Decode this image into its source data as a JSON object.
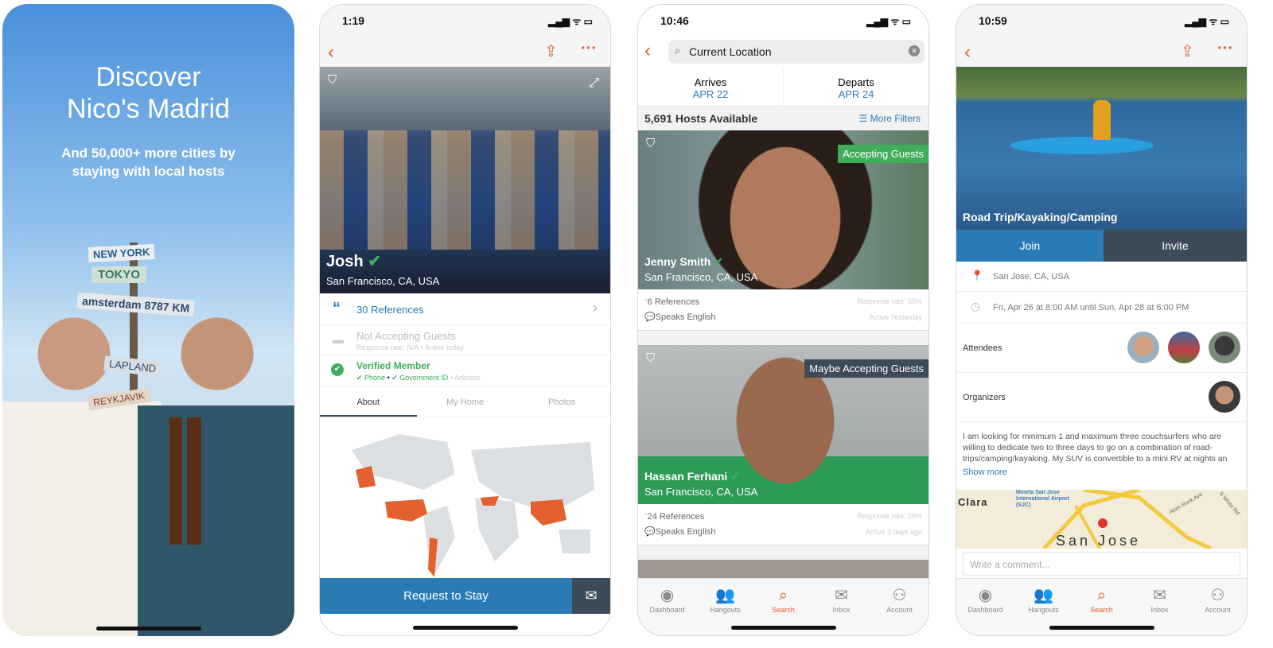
{
  "screen1": {
    "title_line1": "Discover",
    "title_line2": "Nico's Madrid",
    "subtitle_line1": "And 50,000+ more cities by",
    "subtitle_line2": "staying with local hosts",
    "signs": [
      "NEW YORK",
      "TOKYO",
      "amsterdam 8787 KM",
      "LAPLAND",
      "REYKJAVIK"
    ]
  },
  "screen2": {
    "time": "1:19",
    "name": "Josh",
    "location": "San Francisco, CA, USA",
    "references": "30 References",
    "status_title": "Not Accepting Guests",
    "status_sub": "Response rate: N/A • Active today",
    "verified_title": "Verified Member",
    "verified_phone": "✔ Phone",
    "verified_gov": "✔ Government ID",
    "verified_address": "• Address",
    "tabs": [
      "About",
      "My Home",
      "Photos"
    ],
    "request_button": "Request to Stay"
  },
  "screen3": {
    "time": "10:46",
    "search_value": "Current Location",
    "arrives_label": "Arrives",
    "arrives_date": "APR 22",
    "departs_label": "Departs",
    "departs_date": "APR 24",
    "hosts_count": "5,691 Hosts Available",
    "more_filters": "More Filters",
    "hosts": [
      {
        "name": "Jenny Smith",
        "location": "San Francisco, CA, USA",
        "badge": "Accepting Guests",
        "badge_color": "#3fae5a",
        "references": "6 References",
        "language": "Speaks English",
        "response": "Response rate: 50%",
        "active": "Active Yesterday"
      },
      {
        "name": "Hassan Ferhani",
        "location": "San Francisco, CA, USA",
        "badge": "Maybe Accepting Guests",
        "badge_color": "#3d4a57",
        "references": "24 References",
        "language": "Speaks English",
        "response": "Response rate: 25%",
        "active": "Active 2 days ago"
      }
    ]
  },
  "screen4": {
    "time": "10:59",
    "event_title": "Road Trip/Kayaking/Camping",
    "join": "Join",
    "invite": "Invite",
    "location": "San Jose, CA, USA",
    "datetime": "Fri, Apr 26 at 8:00 AM until Sun, Apr 28 at 6:00 PM",
    "attendees_label": "Attendees",
    "organizers_label": "Organizers",
    "description": "I am looking for minimum 1 and maximum three couchsurfers who are willing to dedicate two to three days to go on a combination of road-trips/camping/kayaking. My SUV is convertible to a mini RV at nights an",
    "show_more": "Show more",
    "map_labels": [
      "Clara",
      "Mineta San Jose International Airport (SJC)",
      "Alum Rock Ave",
      "S White Rd",
      "San Jose"
    ],
    "comment_placeholder": "Write a comment..."
  },
  "tabbar": [
    "Dashboard",
    "Hangouts",
    "Search",
    "Inbox",
    "Account"
  ],
  "colors": {
    "accent": "#e4602e",
    "blue": "#2a7ab6",
    "green": "#3fae5a"
  }
}
